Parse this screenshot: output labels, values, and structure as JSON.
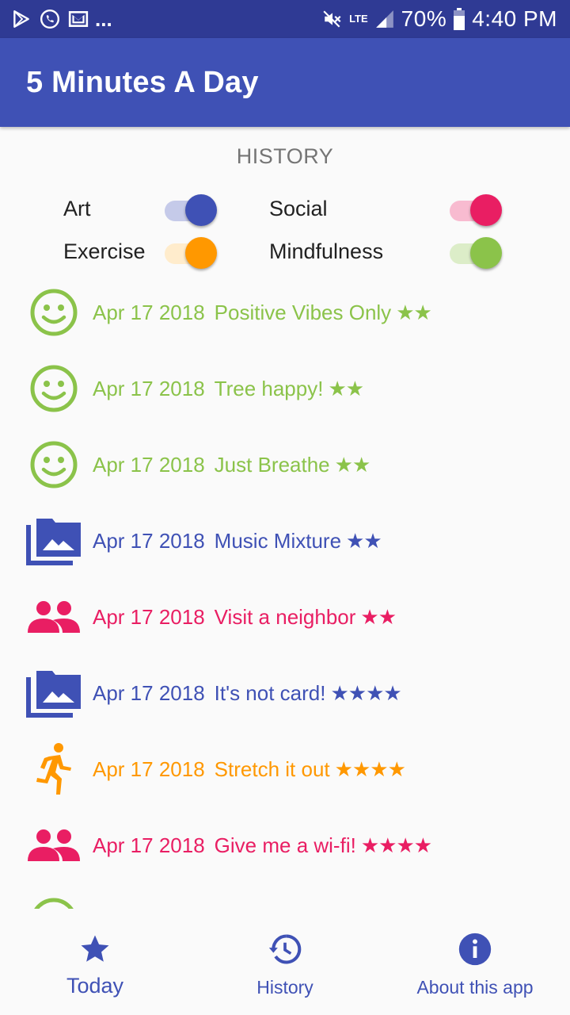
{
  "status_bar": {
    "battery": "70%",
    "time": "4:40 PM",
    "network": "LTE",
    "notification_more": "...",
    "icons": [
      "play-store-icon",
      "phone-icon",
      "gmail-icon",
      "mute-icon",
      "signal-icon",
      "battery-icon"
    ]
  },
  "app_bar": {
    "title": "5 Minutes A Day"
  },
  "history": {
    "title": "HISTORY",
    "filters": [
      {
        "label": "Art",
        "on": true,
        "color": "#3f51b5",
        "track_color": "#c5cae9"
      },
      {
        "label": "Social",
        "on": true,
        "color": "#e91e63",
        "track_color": "#f8bbd0"
      },
      {
        "label": "Exercise",
        "on": true,
        "color": "#ff9800",
        "track_color": "#ffeccc"
      },
      {
        "label": "Mindfulness",
        "on": true,
        "color": "#8bc34a",
        "track_color": "#dcedc8"
      }
    ],
    "entries": [
      {
        "category": "Mindfulness",
        "icon": "smiley-face-icon",
        "date": "Apr 17 2018",
        "title": "Positive Vibes Only",
        "stars": "★★",
        "color": "#8bc34a"
      },
      {
        "category": "Mindfulness",
        "icon": "smiley-face-icon",
        "date": "Apr 17 2018",
        "title": "Tree happy!",
        "stars": "★★",
        "color": "#8bc34a"
      },
      {
        "category": "Mindfulness",
        "icon": "smiley-face-icon",
        "date": "Apr 17 2018",
        "title": "Just Breathe",
        "stars": "★★",
        "color": "#8bc34a"
      },
      {
        "category": "Art",
        "icon": "photo-library-icon",
        "date": "Apr 17 2018",
        "title": "Music Mixture",
        "stars": "★★",
        "color": "#3f51b5"
      },
      {
        "category": "Social",
        "icon": "people-icon",
        "date": "Apr 17 2018",
        "title": "Visit a neighbor",
        "stars": "★★",
        "color": "#e91e63"
      },
      {
        "category": "Art",
        "icon": "photo-library-icon",
        "date": "Apr 17 2018",
        "title": "It's not card!",
        "stars": "★★★★",
        "color": "#3f51b5"
      },
      {
        "category": "Exercise",
        "icon": "running-person-icon",
        "date": "Apr 17 2018",
        "title": "Stretch it out",
        "stars": "★★★★",
        "color": "#ff9800"
      },
      {
        "category": "Social",
        "icon": "people-icon",
        "date": "Apr 17 2018",
        "title": "Give me a wi-fi!",
        "stars": "★★★★",
        "color": "#e91e63"
      }
    ]
  },
  "bottom_nav": {
    "items": [
      {
        "label": "Today",
        "icon": "star-icon",
        "active": true
      },
      {
        "label": "History",
        "icon": "history-icon",
        "active": false
      },
      {
        "label": "About this app",
        "icon": "info-icon",
        "active": false
      }
    ],
    "color": "#3f51b5"
  }
}
